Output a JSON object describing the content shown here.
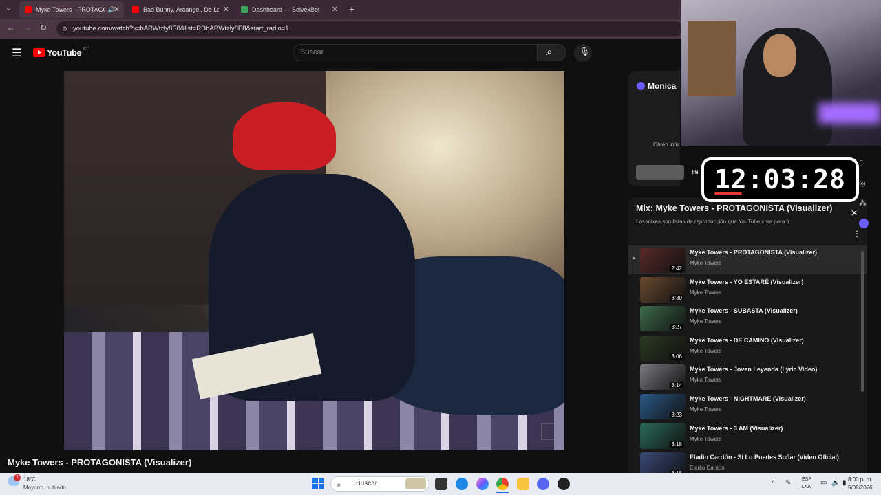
{
  "browser": {
    "tabs": [
      {
        "label": "Myke Towers - PROTAGONI",
        "active": true
      },
      {
        "label": "Bad Bunny, Arcangel, De La Gh",
        "active": false
      },
      {
        "label": "Dashboard — SolvexBot",
        "active": false
      }
    ],
    "url": "youtube.com/watch?v=bARWtzly8E8&list=RDbARWtzly8E8&start_radio=1"
  },
  "youtube": {
    "logo_text": "YouTube",
    "country": "CO",
    "search_placeholder": "Buscar"
  },
  "video": {
    "title": "Myke Towers - PROTAGONISTA (Visualizer)"
  },
  "monica": {
    "name": "Monica",
    "text": "Obtén info",
    "button": "Ini"
  },
  "clock": {
    "time": "12:03:28"
  },
  "playlist": {
    "title": "Mix: Myke Towers - PROTAGONISTA (Visualizer)",
    "subtitle": "Los mixes son listas de reproducción que YouTube crea para ti",
    "items": [
      {
        "title": "Myke Towers - PROTAGONISTA (Visualizer)",
        "channel": "Myke Towers",
        "duration": "2:42",
        "color": "#5a2a2a",
        "current": true
      },
      {
        "title": "Myke Towers - YO ESTARÉ (Visualizer)",
        "channel": "Myke Towers",
        "duration": "3:30",
        "color": "#6a4a30"
      },
      {
        "title": "Myke Towers - SUBASTA (Visualizer)",
        "channel": "Myke Towers",
        "duration": "3:27",
        "color": "#3d6b4a"
      },
      {
        "title": "Myke Towers - DE CAMINO (Visualizer)",
        "channel": "Myke Towers",
        "duration": "3:06",
        "color": "#2c3a22"
      },
      {
        "title": "Myke Towers - Joven Leyenda (Lyric Video)",
        "channel": "Myke Towers",
        "duration": "3:14",
        "color": "#7a7a82"
      },
      {
        "title": "Myke Towers - NIGHTMARE (Visualizer)",
        "channel": "Myke Towers",
        "duration": "3:23",
        "color": "#2a5a8a"
      },
      {
        "title": "Myke Towers - 3 AM (Visualizer)",
        "channel": "Myke Towers",
        "duration": "3:18",
        "color": "#2a6a5a"
      },
      {
        "title": "Eladio Carrión - Si Lo Puedes Soñar (Video Oficial)",
        "channel": "Eladio Carrion",
        "duration": "3:18",
        "color": "#3a4a7a"
      }
    ]
  },
  "taskbar": {
    "weather_temp": "18°C",
    "weather_desc": "Mayorm. nublado",
    "weather_badge": "1",
    "search": "Buscar",
    "lang": "ESP",
    "lang2": "LAA",
    "time": "8:00 p. m.",
    "date": "5/08/2026"
  }
}
